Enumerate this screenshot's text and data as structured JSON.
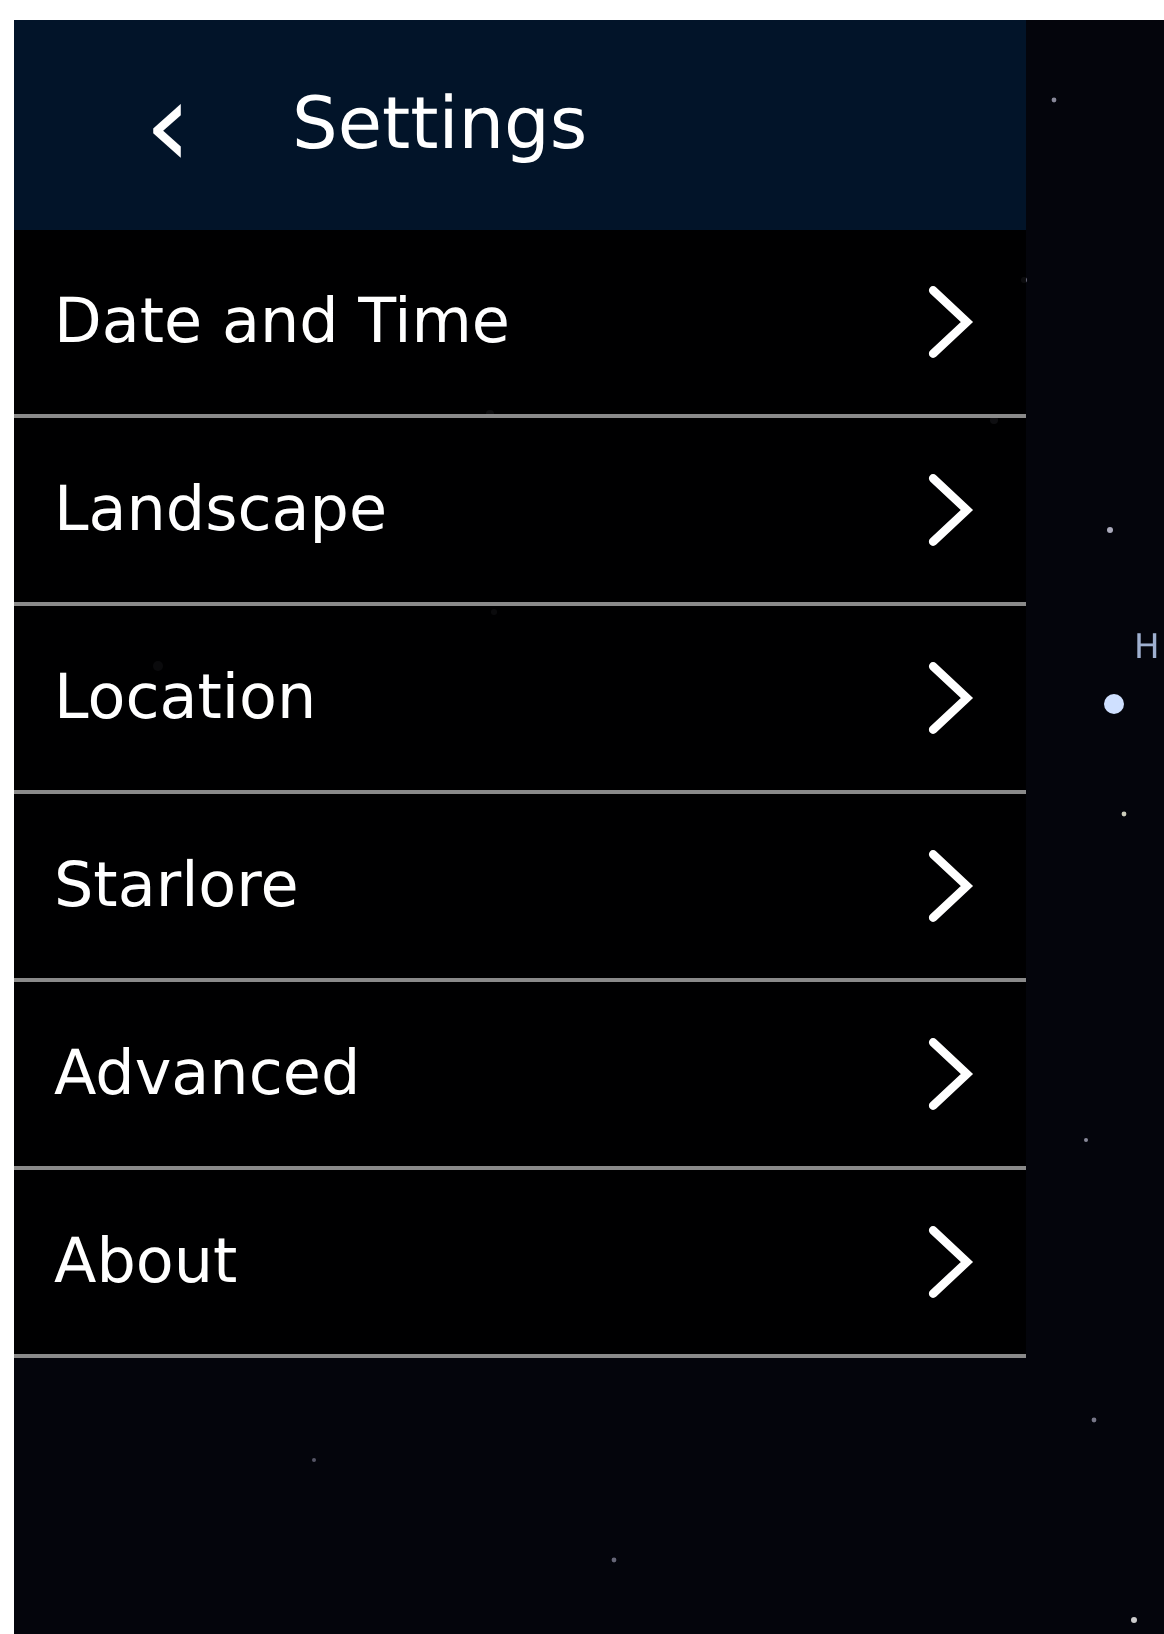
{
  "header": {
    "back_icon": "‹",
    "title": "Settings"
  },
  "menu": [
    {
      "label": "Date and Time"
    },
    {
      "label": "Landscape"
    },
    {
      "label": "Location"
    },
    {
      "label": "Starlore"
    },
    {
      "label": "Advanced"
    },
    {
      "label": "About"
    }
  ],
  "sky": {
    "labels": [
      "H"
    ]
  }
}
